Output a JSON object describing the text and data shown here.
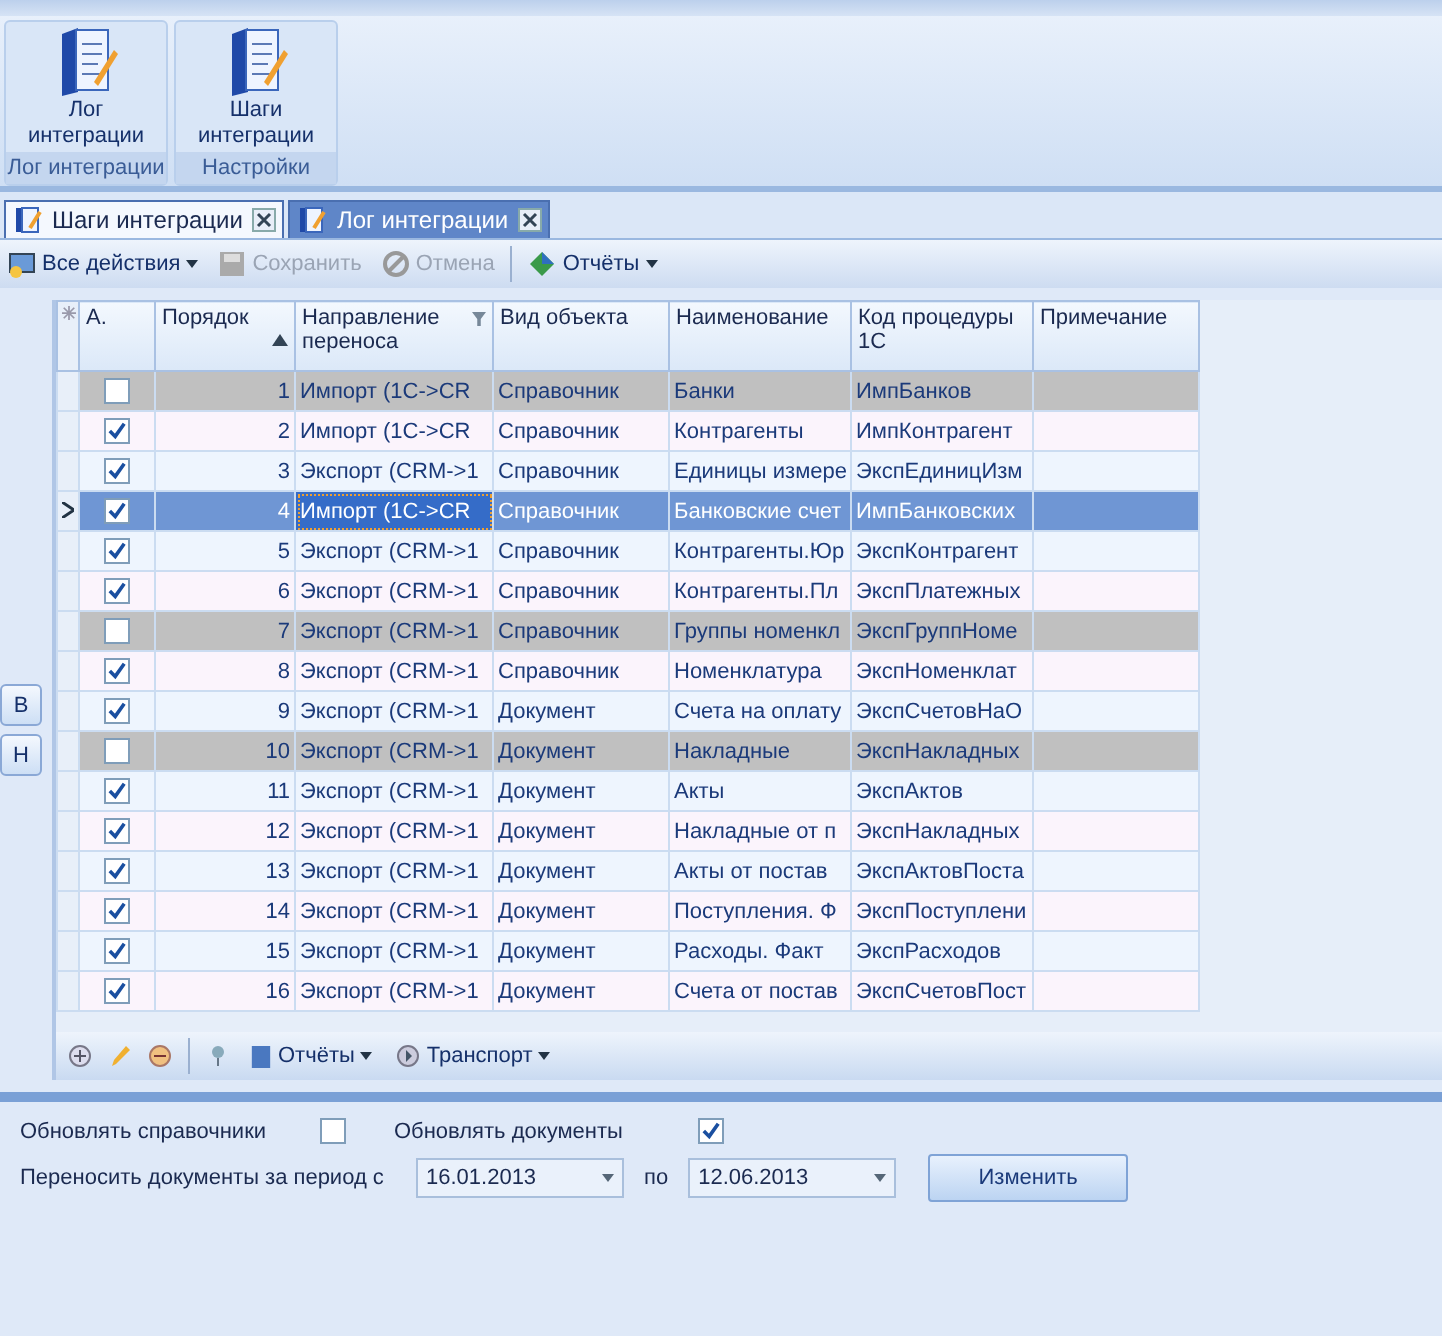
{
  "ribbon": {
    "groups": [
      {
        "button": "Лог интеграции",
        "caption": "Лог интеграции"
      },
      {
        "button": "Шаги интеграции",
        "caption": "Настройки"
      }
    ]
  },
  "tabs": [
    {
      "label": "Шаги интеграции",
      "selected": true
    },
    {
      "label": "Лог интеграции",
      "selected": false
    }
  ],
  "toolbar": [
    {
      "label": "Все действия",
      "disabled": false,
      "dropdown": true,
      "kind": "actions"
    },
    {
      "label": "Сохранить",
      "disabled": true,
      "dropdown": false,
      "kind": "save"
    },
    {
      "label": "Отмена",
      "disabled": true,
      "dropdown": false,
      "kind": "cancel"
    },
    {
      "label": "Отчёты",
      "disabled": false,
      "dropdown": true,
      "kind": "reports"
    }
  ],
  "side_buttons": [
    "В",
    "Н"
  ],
  "table": {
    "columns": [
      "А.",
      "Порядок",
      "Направление переноса",
      "Вид объекта",
      "Наименование",
      "Код процедуры 1С",
      "Примечание"
    ],
    "rows": [
      {
        "active": false,
        "selected": false,
        "order": "1",
        "direction": "Импорт (1C->CR",
        "type": "Справочник",
        "name": "Банки",
        "code": "ИмпБанков"
      },
      {
        "active": true,
        "selected": false,
        "order": "2",
        "direction": "Импорт (1C->CR",
        "type": "Справочник",
        "name": "Контрагенты",
        "code": "ИмпКонтрагент"
      },
      {
        "active": true,
        "selected": false,
        "order": "3",
        "direction": "Экспорт (CRM->1",
        "type": "Справочник",
        "name": "Единицы измере",
        "code": "ЭкспЕдиницИзм"
      },
      {
        "active": true,
        "selected": true,
        "order": "4",
        "direction": "Импорт (1C->CR",
        "type": "Справочник",
        "name": "Банковские счет",
        "code": "ИмпБанковских"
      },
      {
        "active": true,
        "selected": false,
        "order": "5",
        "direction": "Экспорт (CRM->1",
        "type": "Справочник",
        "name": "Контрагенты.Юр",
        "code": "ЭкспКонтрагент"
      },
      {
        "active": true,
        "selected": false,
        "order": "6",
        "direction": "Экспорт (CRM->1",
        "type": "Справочник",
        "name": "Контрагенты.Пл",
        "code": "ЭкспПлатежных"
      },
      {
        "active": false,
        "selected": false,
        "order": "7",
        "direction": "Экспорт (CRM->1",
        "type": "Справочник",
        "name": "Группы номенкл",
        "code": "ЭкспГруппНоме"
      },
      {
        "active": true,
        "selected": false,
        "order": "8",
        "direction": "Экспорт (CRM->1",
        "type": "Справочник",
        "name": "Номенклатура",
        "code": "ЭкспНоменклат"
      },
      {
        "active": true,
        "selected": false,
        "order": "9",
        "direction": "Экспорт (CRM->1",
        "type": "Документ",
        "name": "Счета на оплату",
        "code": "ЭкспСчетовНаО"
      },
      {
        "active": false,
        "selected": false,
        "order": "10",
        "direction": "Экспорт (CRM->1",
        "type": "Документ",
        "name": "Накладные",
        "code": "ЭкспНакладных"
      },
      {
        "active": true,
        "selected": false,
        "order": "11",
        "direction": "Экспорт (CRM->1",
        "type": "Документ",
        "name": "Акты",
        "code": "ЭкспАктов"
      },
      {
        "active": true,
        "selected": false,
        "order": "12",
        "direction": "Экспорт (CRM->1",
        "type": "Документ",
        "name": "Накладные от п",
        "code": "ЭкспНакладных"
      },
      {
        "active": true,
        "selected": false,
        "order": "13",
        "direction": "Экспорт (CRM->1",
        "type": "Документ",
        "name": "Акты от постав",
        "code": "ЭкспАктовПоста"
      },
      {
        "active": true,
        "selected": false,
        "order": "14",
        "direction": "Экспорт (CRM->1",
        "type": "Документ",
        "name": "Поступления. Ф",
        "code": "ЭкспПоступлени"
      },
      {
        "active": true,
        "selected": false,
        "order": "15",
        "direction": "Экспорт (CRM->1",
        "type": "Документ",
        "name": "Расходы. Факт",
        "code": "ЭкспРасходов"
      },
      {
        "active": true,
        "selected": false,
        "order": "16",
        "direction": "Экспорт (CRM->1",
        "type": "Документ",
        "name": "Счета от постав",
        "code": "ЭкспСчетовПост"
      }
    ]
  },
  "bottom_toolbar": [
    "Отчёты",
    "Транспорт"
  ],
  "form": {
    "update_refs": {
      "label": "Обновлять справочники",
      "checked": false
    },
    "update_docs": {
      "label": "Обновлять документы",
      "checked": true
    },
    "period_label": "Переносить документы за период с",
    "date_from": "16.01.2013",
    "to_label": "по",
    "date_to": "12.06.2013",
    "button": "Изменить"
  }
}
